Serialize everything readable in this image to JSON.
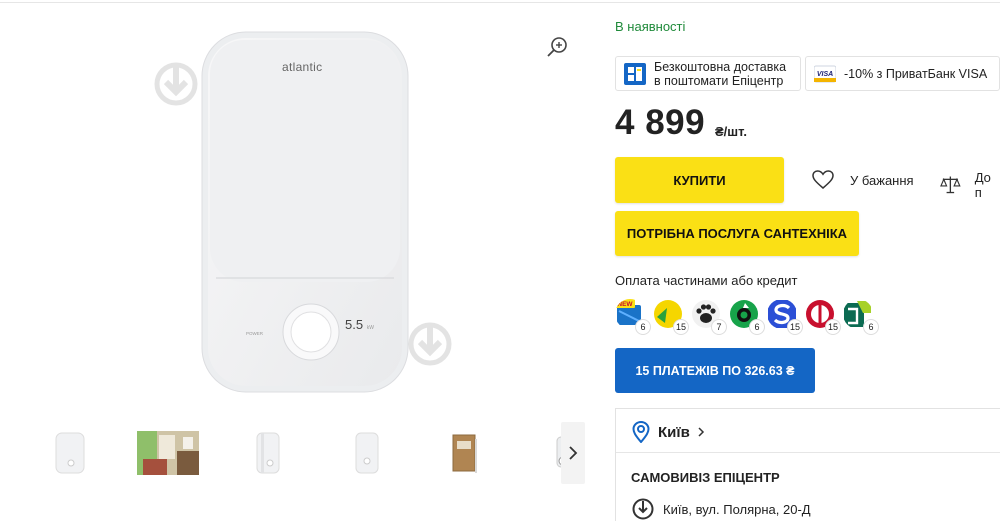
{
  "product": {
    "availability": "В наявності",
    "price": "4 899",
    "price_unit": "₴/шт.",
    "device_brand": "atlantic",
    "device_power": "5.5",
    "device_power_unit": "kW",
    "device_label": "POWER"
  },
  "promos": [
    {
      "icon": "parcel-locker-icon",
      "text_line1": "Безкоштовна доставка",
      "text_line2": "в поштомати Епіцентр"
    },
    {
      "icon": "visa-icon",
      "icon_text": "VISA",
      "text": "-10% з ПриватБанк VISA"
    }
  ],
  "actions": {
    "buy_label": "КУПИТИ",
    "wishlist_label": "У бажання",
    "compare_label": "До п",
    "service_label": "ПОТРІБНА ПОСЛУГА САНТЕХНІКА"
  },
  "credit": {
    "title": "Оплата частинами або кредит",
    "banks": [
      {
        "icon": "bank-new-icon",
        "badge": "NEW",
        "count": "6",
        "color": "#1a73c8"
      },
      {
        "icon": "bank-yellow-icon",
        "count": "15",
        "color": "#f5d600"
      },
      {
        "icon": "bank-paw-icon",
        "count": "7",
        "color": "#222222"
      },
      {
        "icon": "bank-green-icon",
        "count": "6",
        "color": "#17a34a"
      },
      {
        "icon": "bank-s-icon",
        "count": "15",
        "color": "#2b4fd6"
      },
      {
        "icon": "bank-red-icon",
        "count": "15",
        "color": "#c8102e"
      },
      {
        "icon": "bank-teal-icon",
        "count": "6",
        "color": "#0b6b52"
      }
    ],
    "installments_label": "15 ПЛАТЕЖІВ ПО 326.63 ₴"
  },
  "pickup": {
    "city": "Київ",
    "title": "САМОВИВІЗ ЕПІЦЕНТР",
    "store_address": "Київ, вул. Полярна, 20-Д"
  },
  "colors": {
    "accent_yellow": "#fae015",
    "accent_blue": "#1466c5",
    "available_green": "#1f8a3a"
  }
}
